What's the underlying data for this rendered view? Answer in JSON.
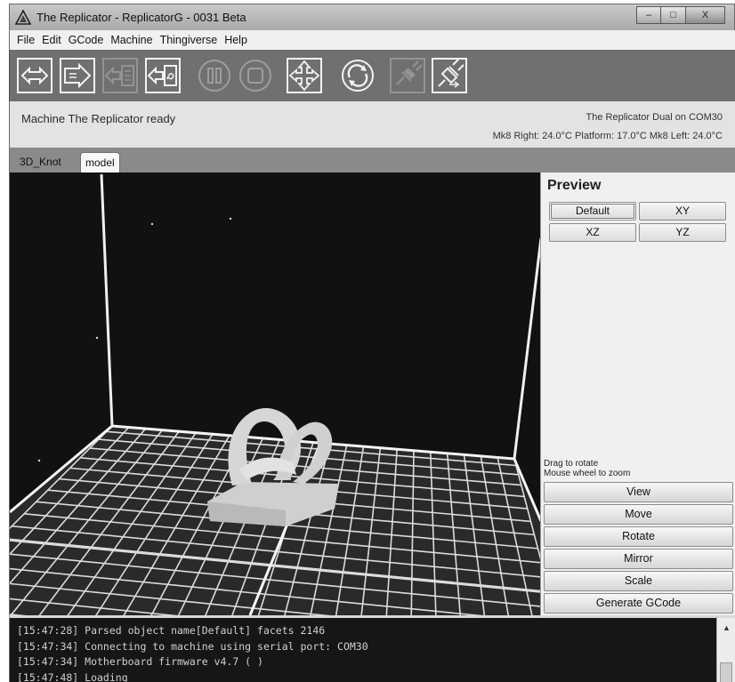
{
  "window": {
    "title": "The Replicator - ReplicatorG - 0031 Beta",
    "minimize": "–",
    "maximize": "□",
    "close": "X"
  },
  "menu": [
    "File",
    "Edit",
    "GCode",
    "Machine",
    "Thingiverse",
    "Help"
  ],
  "toolbar": [
    {
      "icon": "build-icon",
      "enabled": true
    },
    {
      "icon": "build-to-file-icon",
      "enabled": true
    },
    {
      "icon": "upload-to-sd-icon",
      "enabled": false
    },
    {
      "icon": "build-from-sd-icon",
      "enabled": true
    },
    {
      "icon": "pause-icon",
      "enabled": false
    },
    {
      "icon": "stop-icon",
      "enabled": false
    },
    {
      "icon": "control-panel-icon",
      "enabled": true
    },
    {
      "icon": "reset-icon",
      "enabled": true
    },
    {
      "icon": "connect-icon",
      "enabled": false
    },
    {
      "icon": "disconnect-icon",
      "enabled": true
    }
  ],
  "status": {
    "message": "Machine The Replicator ready",
    "machine": "The Replicator Dual on COM30",
    "temperatures": "Mk8 Right: 24.0°C  Platform: 17.0°C Mk8 Left: 24.0°C"
  },
  "tabs": [
    {
      "label": "3D_Knot",
      "active": false
    },
    {
      "label": "model",
      "active": true
    }
  ],
  "preview": {
    "title": "Preview",
    "buttons": [
      "Default",
      "XY",
      "XZ",
      "YZ"
    ],
    "focused": "Default",
    "hint_rotate": "Drag to rotate",
    "hint_zoom": "Mouse wheel to zoom"
  },
  "actions": [
    "View",
    "Move",
    "Rotate",
    "Mirror",
    "Scale",
    "Generate GCode"
  ],
  "console": [
    "[15:47:28] Parsed object name[Default] facets 2146",
    "[15:47:34] Connecting to machine using serial port: COM30",
    "[15:47:34] Motherboard firmware v4.7 ( )",
    "[15:47:48] Loading"
  ],
  "colors": {
    "viewport_background": "#111111",
    "grid": "#e6e6e6",
    "model": "#dcdcdc",
    "toolbar": "#707070"
  }
}
